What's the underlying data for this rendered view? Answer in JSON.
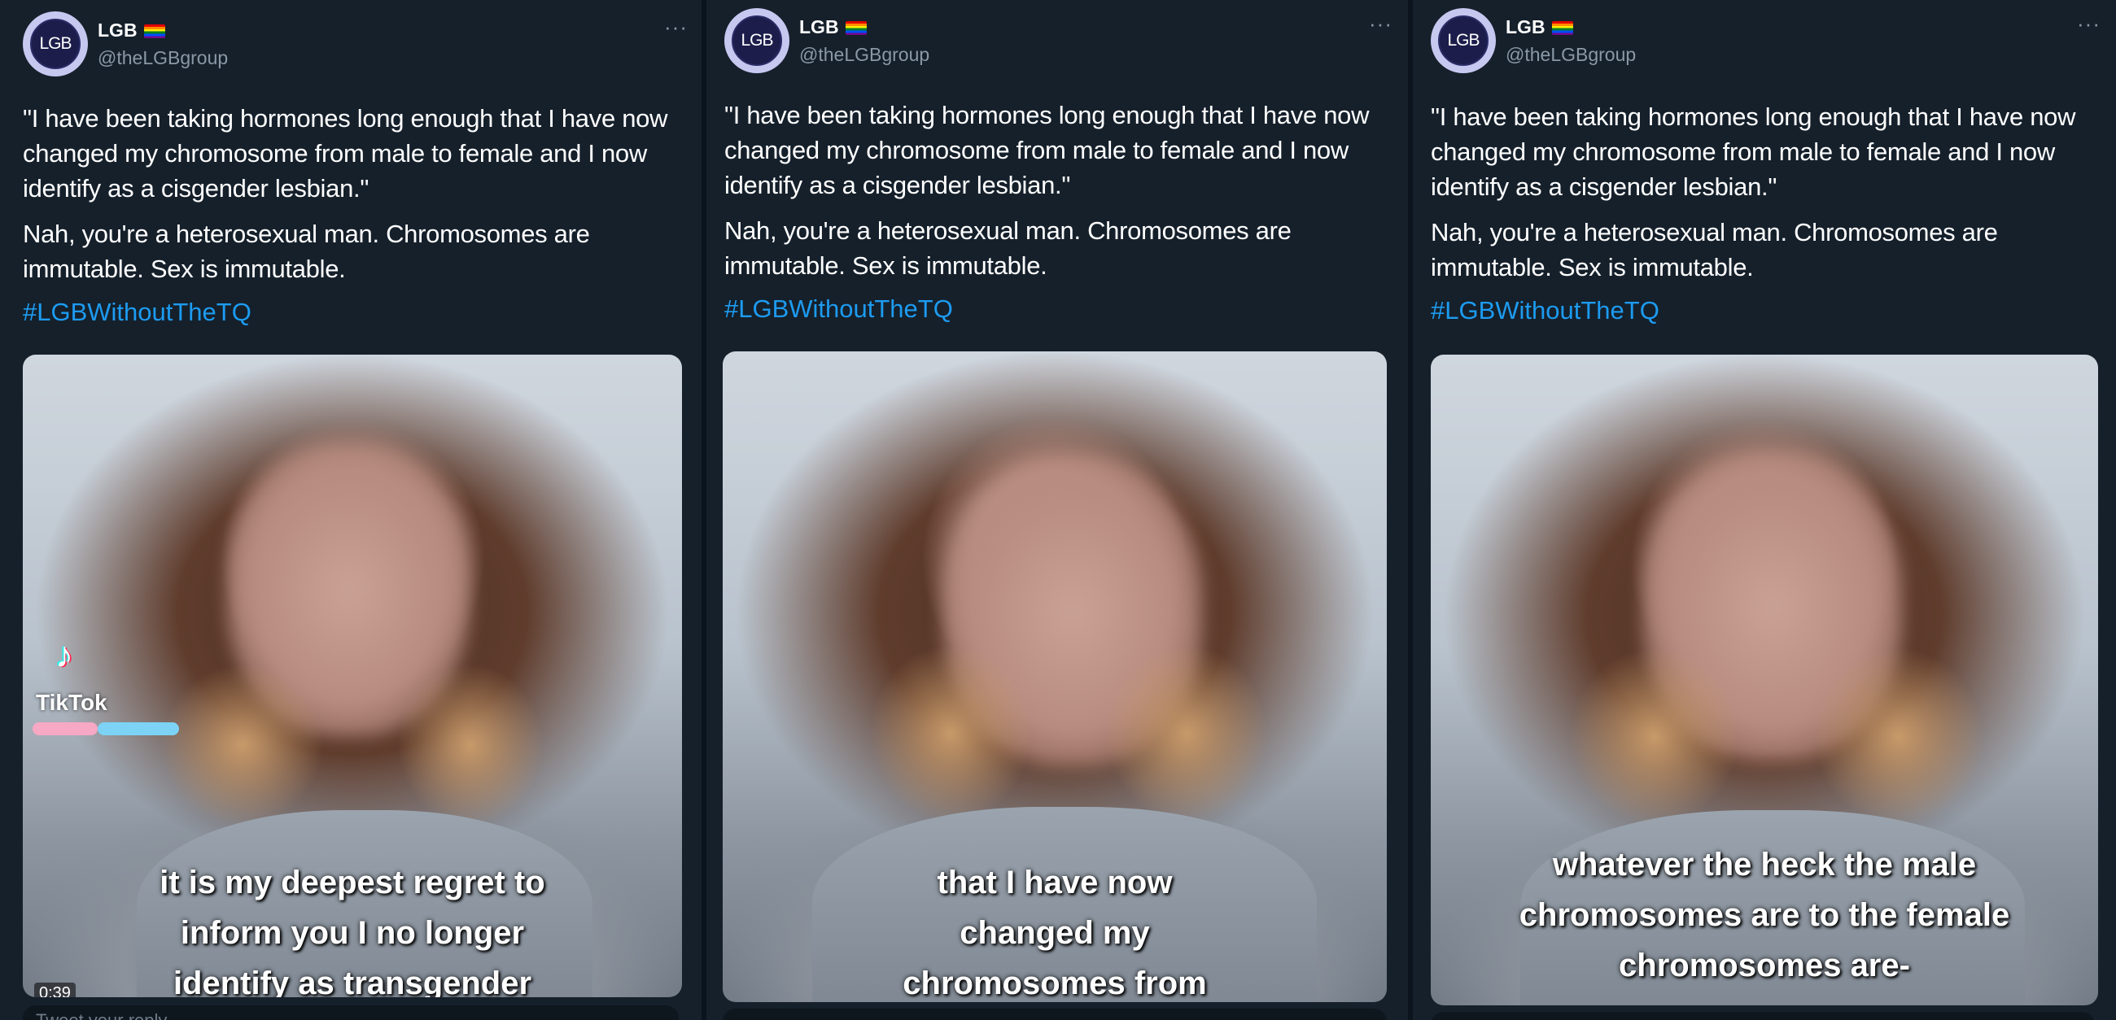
{
  "panels": [
    {
      "display_name": "LGB",
      "handle": "@theLGBgroup",
      "avatar_text": "LGB",
      "more_label": "···",
      "quote": "\"I have been taking hormones long enough that I have now changed my chromosome from male to female and I now identify as a cisgender lesbian.\"",
      "reply": "Nah, you're a heterosexual man. Chromosomes are immutable. Sex is immutable.",
      "hashtag": "#LGBWithoutTheTQ",
      "caption": "it is my deepest regret to inform you I no longer identify as transgender",
      "watermark": "TikTok",
      "duration": "0:39",
      "reply_placeholder": "Tweet your reply"
    },
    {
      "display_name": "LGB",
      "handle": "@theLGBgroup",
      "avatar_text": "LGB",
      "more_label": "···",
      "quote": "\"I have been taking hormones long enough that I have now changed my chromosome from male to female and I now identify as a cisgender lesbian.\"",
      "reply": "Nah, you're a heterosexual man. Chromosomes are immutable. Sex is immutable.",
      "hashtag": "#LGBWithoutTheTQ",
      "caption": "that I have now changed my chromosomes from"
    },
    {
      "display_name": "LGB",
      "handle": "@theLGBgroup",
      "avatar_text": "LGB",
      "more_label": "···",
      "quote": "\"I have been taking hormones long enough that I have now changed my chromosome from male to female and I now identify as a cisgender lesbian.\"",
      "reply": "Nah, you're a heterosexual man. Chromosomes are immutable. Sex is immutable.",
      "hashtag": "#LGBWithoutTheTQ",
      "caption": "whatever the heck the male chromosomes are to the female chromosomes are-"
    }
  ],
  "colors": {
    "background": "#15202b",
    "text": "#ffffff",
    "secondary_text": "#8b98a5",
    "link": "#1d9bf0",
    "avatar_ring": "#c7c8f0",
    "avatar_fill": "#1c1d4a"
  },
  "icons": {
    "more": "more-options-icon",
    "flag": "rainbow-flag-icon",
    "tiktok": "tiktok-logo-icon"
  }
}
